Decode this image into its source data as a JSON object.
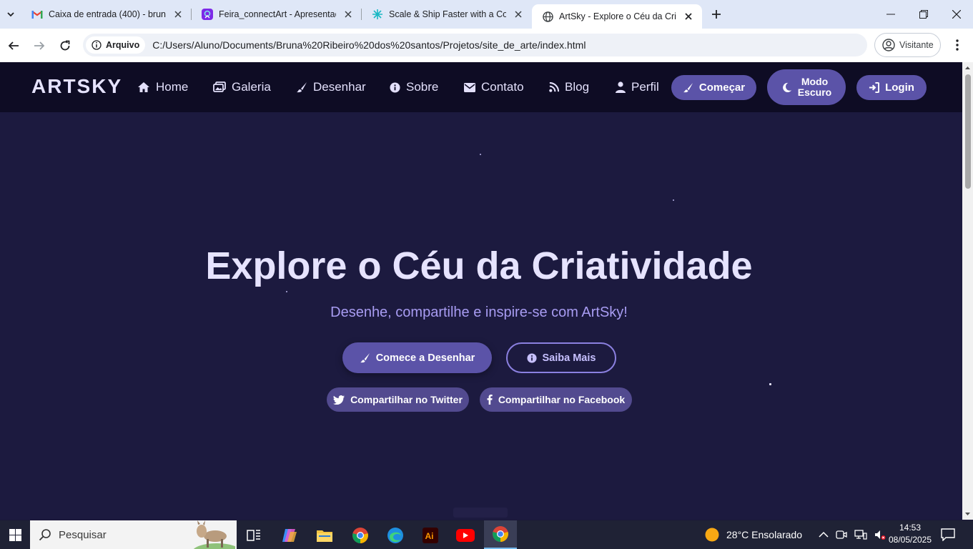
{
  "browser": {
    "tabs": [
      {
        "title": "Caixa de entrada (400) - bruna",
        "icon": "gmail-icon",
        "active": false
      },
      {
        "title": "Feira_connectArt - Apresentaçã",
        "icon": "canva-icon",
        "active": false
      },
      {
        "title": "Scale & Ship Faster with a Com",
        "icon": "figma-icon",
        "active": false
      },
      {
        "title": "ArtSky - Explore o Céu da Criati",
        "icon": "globe-icon",
        "active": true
      }
    ],
    "address_chip": "Arquivo",
    "url": "C:/Users/Aluno/Documents/Bruna%20Ribeiro%20dos%20santos/Projetos/site_de_arte/index.html",
    "profile_label": "Visitante"
  },
  "site": {
    "logo": "ARTSKY",
    "nav": {
      "home": "Home",
      "galeria": "Galeria",
      "desenhar": "Desenhar",
      "sobre": "Sobre",
      "contato": "Contato",
      "blog": "Blog",
      "perfil": "Perfil"
    },
    "buttons": {
      "comecar": "Começar",
      "modo_line1": "Modo",
      "modo_line2": "Escuro",
      "login": "Login"
    },
    "hero": {
      "title": "Explore o Céu da Criatividade",
      "subtitle": "Desenhe, compartilhe e inspire-se com ArtSky!",
      "primary_cta": "Comece a Desenhar",
      "secondary_cta": "Saiba Mais",
      "share_twitter": "Compartilhar no Twitter",
      "share_facebook": "Compartilhar no Facebook"
    },
    "colors": {
      "navbar_bg": "#0e0c24",
      "page_bg": "#1c1a3f",
      "button_bg": "#5b53a8",
      "accent_text": "#a89cf2"
    }
  },
  "taskbar": {
    "search_placeholder": "Pesquisar",
    "weather": "28°C  Ensolarado",
    "time": "14:53",
    "date": "08/05/2025"
  }
}
